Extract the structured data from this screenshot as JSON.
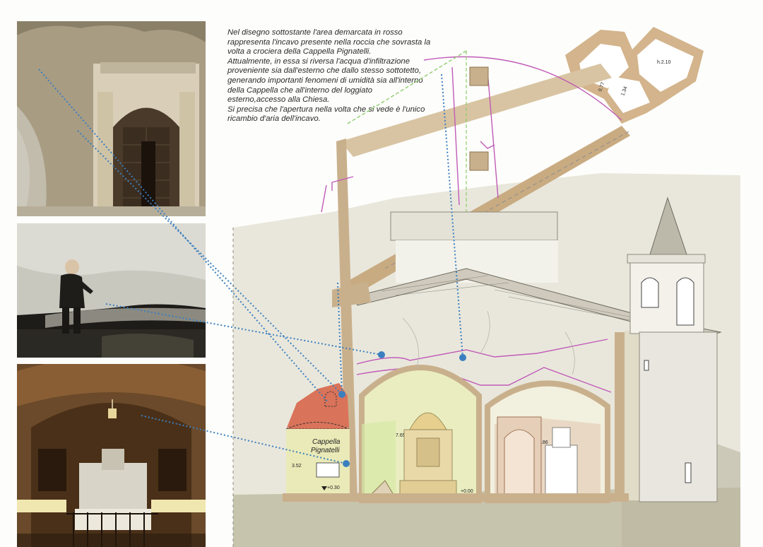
{
  "caption": "Nel disegno sottostante l'area demarcata in rosso\nrappresenta l'incavo presente nella roccia che sovrasta la\nvolta a crociera della Cappella Pignatelli.\nAttualmente, in essa si riversa l'acqua d'infiltrazione\nproveniente sia dall'esterno che dallo stesso sottotetto,\ngenerando importanti fenomeni di umidità sia all'interno\ndella Cappella che all'interno del loggiato\nesterno,accesso alla Chiesa.\nSi precisa che l'apertura nella volta che si vede è l'unico\nricambio d'aria dell'incavo.",
  "labels": {
    "cappella_line1": "Cappella",
    "cappella_line2": "Pignatelli",
    "height_left": "3.52",
    "height_center": "7.65",
    "height_right": "6.86",
    "level_left": "+0.30",
    "level_center": "+0.00",
    "plan_h": "h.2.10",
    "plan_dim_1": "0.77",
    "plan_dim_2": "1.34"
  },
  "colors": {
    "highlight_red": "#d9735a",
    "leader_blue": "#3b7fbf",
    "wall": "#c9b08c",
    "ground": "#c7c4ad",
    "vault_fill": "#eaeab8",
    "pipe_magenta": "#c05bb8"
  }
}
